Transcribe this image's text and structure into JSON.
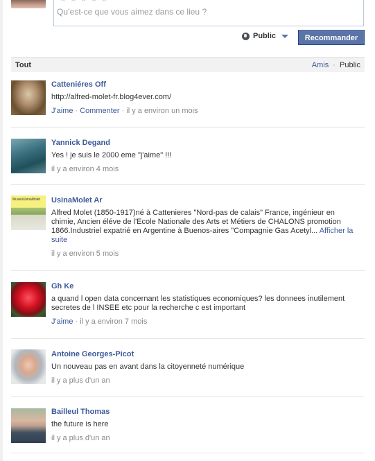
{
  "composer": {
    "placeholder": "Qu’est-ce que vous aimez dans ce lieu ?",
    "stars": "★★★★★"
  },
  "privacy": {
    "label": "Public"
  },
  "recommend_label": "Recommander",
  "filter": {
    "tout": "Tout",
    "amis": "Amis",
    "separator": "·",
    "public": "Public"
  },
  "posts": [
    {
      "name": "Catteniéres Off",
      "text": "http://alfred-molet-fr.blog4ever.com/",
      "jaime": "J'aime",
      "commenter": "Commenter",
      "time": "il y a environ un mois"
    },
    {
      "name": "Yannick Degand",
      "text": "Yes ! je suis le 2000 eme \"j'aime\" !!!",
      "time": "il y a environ 4 mois"
    },
    {
      "name": "UsinaMolet Ar",
      "avatar_text": "MuseoUsinaMolet",
      "text": "Alfred Molet (1850-1917)né à Cattenieres \"Nord-pas de calais\" France, ingénieur en chimie, Ancien éléve de l'Ecole Nationale des Arts et Métiers de CHALONS promotion 1866.Industriel expatrié en Argentine à Buenos-aires \"Compagnie Gas Acetyl...",
      "more": "Afficher la suite",
      "time": "il y a environ 5 mois"
    },
    {
      "name": "Gh Ke",
      "text": "a quand l open data concernant les statistiques economiques? les donnees inutilement secretes de l INSEE etc pour la recherche c est important",
      "jaime": "J'aime",
      "time": "il y a environ 7 mois"
    },
    {
      "name": "Antoine Georges-Picot",
      "text": "Un nouveau pas en avant dans la citoyenneté numérique",
      "time": "il y a plus d'un an"
    },
    {
      "name": "Bailleul Thomas",
      "text": "the future is here",
      "time": "il y a plus d'un an"
    }
  ],
  "icons": {
    "globe": "globe-icon",
    "caret": "caret-down-icon",
    "star": "star-icon"
  },
  "colors": {
    "link": "#3b5998",
    "button": "#5b74a8",
    "meta": "#888888"
  }
}
